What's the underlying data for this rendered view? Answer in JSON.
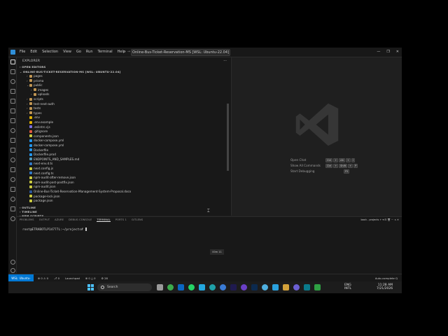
{
  "window": {
    "menu": [
      "File",
      "Edit",
      "Selection",
      "View",
      "Go",
      "Run",
      "Terminal",
      "Help"
    ],
    "search_text": "Online-Bus-Ticket-Reservation-MS [WSL: Ubuntu-22.04]",
    "nav_back": "←",
    "nav_forward": "→",
    "win_minimize": "—",
    "win_restore": "❐",
    "win_close": "✕"
  },
  "sidebar": {
    "title": "EXPLORER",
    "more": "···",
    "open_editors": "OPEN EDITORS",
    "workspace": "ONLINE-BUS-TICKET-RESERVATION-MS [WSL: UBUNTU-22.04]",
    "tree": [
      {
        "label": "pages",
        "indent": 1,
        "kind": "folder"
      },
      {
        "label": "prisma",
        "indent": 1,
        "kind": "folder"
      },
      {
        "label": "public",
        "indent": 1,
        "kind": "folder-open"
      },
      {
        "label": "images",
        "indent": 2,
        "kind": "folder"
      },
      {
        "label": "uploads",
        "indent": 2,
        "kind": "folder"
      },
      {
        "label": "scripts",
        "indent": 1,
        "kind": "folder"
      },
      {
        "label": "test-next-auth",
        "indent": 1,
        "kind": "folder"
      },
      {
        "label": "tests",
        "indent": 1,
        "kind": "folder"
      },
      {
        "label": "types",
        "indent": 1,
        "kind": "folder"
      },
      {
        "label": ".env",
        "indent": 1,
        "kind": "env"
      },
      {
        "label": ".env.example",
        "indent": 1,
        "kind": "env"
      },
      {
        "label": ".eslintrc.cjs",
        "indent": 1,
        "kind": "eslint"
      },
      {
        "label": ".gitignore",
        "indent": 1,
        "kind": "git"
      },
      {
        "label": "components.json",
        "indent": 1,
        "kind": "json"
      },
      {
        "label": "docker-compose.yml",
        "indent": 1,
        "kind": "docker"
      },
      {
        "label": "docker-compose.yml",
        "indent": 1,
        "kind": "docker"
      },
      {
        "label": "Dockerfile",
        "indent": 1,
        "kind": "docker"
      },
      {
        "label": "Dockerfile.prod",
        "indent": 1,
        "kind": "docker"
      },
      {
        "label": "ENDPOINTS_AND_SAMPLES.md",
        "indent": 1,
        "kind": "md"
      },
      {
        "label": "next-env.d.ts",
        "indent": 1,
        "kind": "ts"
      },
      {
        "label": "next.config.js",
        "indent": 1,
        "kind": "js"
      },
      {
        "label": "next.config.ts",
        "indent": 1,
        "kind": "ts"
      },
      {
        "label": "npm-audit-after-remove.json",
        "indent": 1,
        "kind": "json"
      },
      {
        "label": "npm-audit-post-postfix.json",
        "indent": 1,
        "kind": "json"
      },
      {
        "label": "npm-audit.json",
        "indent": 1,
        "kind": "json"
      },
      {
        "label": "Online-Bus-Ticket-Reservation-Management-System-Proposal.docx",
        "indent": 1,
        "kind": "doc"
      },
      {
        "label": "package-lock.json",
        "indent": 1,
        "kind": "json"
      },
      {
        "label": "package.json",
        "indent": 1,
        "kind": "json"
      }
    ],
    "outline": "OUTLINE",
    "timeline": "TIMELINE",
    "npm_scripts": "NPM SCRIPTS"
  },
  "editor": {
    "hints": [
      {
        "label": "Open Chat",
        "keys": [
          "Ctrl",
          "+",
          "Alt",
          "+",
          "I"
        ]
      },
      {
        "label": "Show All Commands",
        "keys": [
          "Ctrl",
          "+",
          "Shift",
          "+",
          "P"
        ]
      },
      {
        "label": "Start Debugging",
        "keys": [
          "F5"
        ]
      }
    ]
  },
  "panel": {
    "tabs": [
      "PROBLEMS",
      "OUTPUT",
      "AZURE",
      "DEBUG CONSOLE",
      "TERMINAL",
      "PORTS",
      "GITLENS"
    ],
    "active_tab": "TERMINAL",
    "ports_badge": "1",
    "tools": "bash - projects  +  ▾  ⊟  🗑  ···  ∧  ✕",
    "prompt": "root@ETRABOTLP14777L:~/projects#",
    "timer": "00m 11"
  },
  "statusbar": {
    "remote": "WSL: Ubuntu-22.04",
    "items": [
      "⊗ 0 ⚠ 0",
      "⎇ 0",
      "Launchpad",
      "⊗ 0 △ 0",
      "⚙ 28"
    ],
    "right": "Auto-complete  Q"
  },
  "taskbar": {
    "search_label": "Search",
    "lang_top": "ENG",
    "lang_bottom": "INTL",
    "time": "11:28 AM",
    "date": "7/21/2026"
  }
}
